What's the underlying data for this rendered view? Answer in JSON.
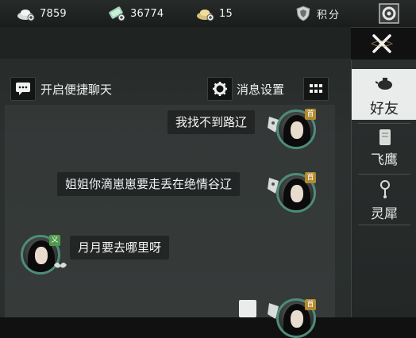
{
  "currency": {
    "silver": "7859",
    "jade": "36774",
    "gold": "15",
    "points_label": "积分"
  },
  "toolbar": {
    "quick_chat_label": "开启便捷聊天",
    "settings_label": "消息设置"
  },
  "messages": [
    {
      "side": "right",
      "text": "我找不到路辽",
      "badge": "首"
    },
    {
      "side": "right",
      "text": "姐姐你滴崽崽要走丢在绝情谷辽",
      "badge": "首"
    },
    {
      "side": "left",
      "text": "月月要去哪里呀",
      "badge": "义"
    },
    {
      "side": "right",
      "text": "",
      "badge": "首"
    }
  ],
  "tabs": [
    {
      "label": "好友",
      "active": true
    },
    {
      "label": "飞鹰",
      "active": false
    },
    {
      "label": "灵犀",
      "active": false
    }
  ],
  "colors": {
    "avatar_ring": "#4d8c7a",
    "badge": "#b58a2e",
    "active_tab": "#e9ecea"
  }
}
